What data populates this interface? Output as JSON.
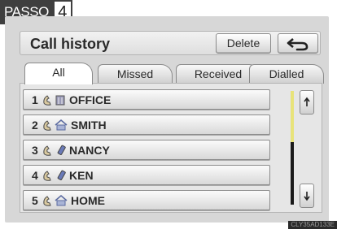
{
  "step_badge": {
    "word": "PASSO",
    "number": "4"
  },
  "header": {
    "title": "Call history",
    "delete_label": "Delete",
    "back_icon": "return-arrow-icon"
  },
  "tabs": [
    {
      "label": "All",
      "active": true
    },
    {
      "label": "Missed",
      "active": false
    },
    {
      "label": "Received",
      "active": false
    },
    {
      "label": "Dialled",
      "active": false
    }
  ],
  "entries": [
    {
      "index": "1",
      "name": "OFFICE",
      "type_icon": "phone-icon",
      "label_icon": "office-building-icon"
    },
    {
      "index": "2",
      "name": "SMITH",
      "type_icon": "phone-icon",
      "label_icon": "home-icon"
    },
    {
      "index": "3",
      "name": "NANCY",
      "type_icon": "phone-icon",
      "label_icon": "mobile-phone-icon"
    },
    {
      "index": "4",
      "name": "KEN",
      "type_icon": "phone-icon",
      "label_icon": "mobile-phone-icon"
    },
    {
      "index": "5",
      "name": "HOME",
      "type_icon": "phone-icon",
      "label_icon": "home-icon"
    }
  ],
  "scrollbar": {
    "position": 0.0,
    "visible_fraction": 0.45
  },
  "image_code": "CLY35AD133E",
  "colors": {
    "scroll_thumb": "#e8e37a",
    "badge": "#3f3f3f"
  }
}
